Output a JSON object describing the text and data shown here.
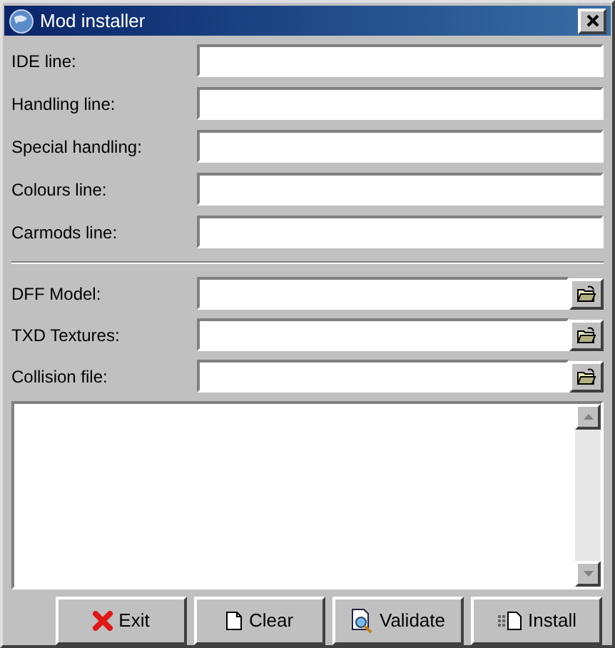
{
  "window": {
    "title": "Mod installer"
  },
  "text_fields": [
    {
      "label": "IDE line:"
    },
    {
      "label": "Handling line:"
    },
    {
      "label": "Special handling:"
    },
    {
      "label": "Colours line:"
    },
    {
      "label": "Carmods line:"
    }
  ],
  "file_fields": [
    {
      "label": "DFF Model:"
    },
    {
      "label": "TXD Textures:"
    },
    {
      "label": "Collision file:"
    }
  ],
  "buttons": [
    {
      "label": "Exit",
      "kind": "exit"
    },
    {
      "label": "Clear",
      "kind": "clear"
    },
    {
      "label": "Validate",
      "kind": "validate"
    },
    {
      "label": "Install",
      "kind": "install"
    }
  ]
}
